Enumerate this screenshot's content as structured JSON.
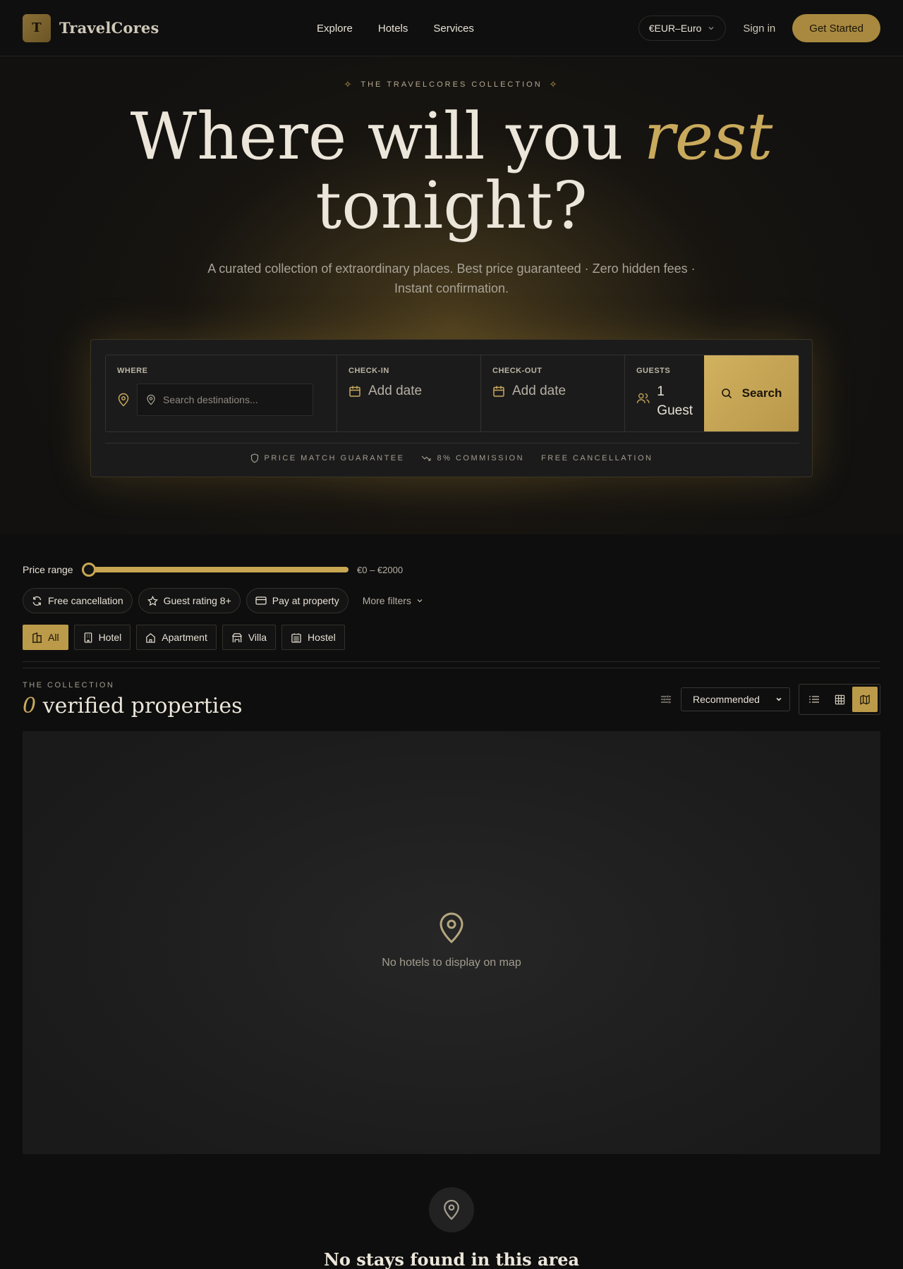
{
  "header": {
    "logo_letter": "T",
    "brand": "TravelCores",
    "nav": [
      "Explore",
      "Hotels",
      "Services"
    ],
    "currency": "€EUR–Euro",
    "sign_in": "Sign in",
    "get_started": "Get Started"
  },
  "hero": {
    "eyebrow": "THE TRAVELCORES COLLECTION",
    "title_line1": "Where will you",
    "title_accent": "rest",
    "title_line2": "tonight?",
    "subtitle": "A curated collection of extraordinary places. Best price guaranteed · Zero hidden fees · Instant confirmation."
  },
  "search": {
    "where_label": "WHERE",
    "where_placeholder": "Search destinations...",
    "checkin_label": "CHECK-IN",
    "checkin_value": "Add date",
    "checkout_label": "CHECK-OUT",
    "checkout_value": "Add date",
    "guests_label": "GUESTS",
    "guests_count": "1",
    "guests_unit": "Guest",
    "button": "Search",
    "badges": [
      "PRICE MATCH GUARANTEE",
      "8% COMMISSION",
      "FREE CANCELLATION"
    ]
  },
  "filters": {
    "price_label": "Price range",
    "price_value": "€0 – €2000",
    "price_slider_position": 0,
    "chips": [
      "Free cancellation",
      "Guest rating 8+",
      "Pay at property"
    ],
    "more": "More filters",
    "types": [
      "All",
      "Hotel",
      "Apartment",
      "Villa",
      "Hostel"
    ],
    "active_type": "All"
  },
  "collection": {
    "eyebrow": "THE COLLECTION",
    "count": "0",
    "title": "verified properties",
    "sort": "Recommended",
    "views": [
      "list",
      "grid",
      "map"
    ],
    "active_view": "map"
  },
  "map": {
    "empty_text": "No hotels to display on map"
  },
  "empty_state": {
    "title": "No stays found in this area"
  },
  "colors": {
    "gold": "#c9aa5c",
    "background": "#0e0e0e"
  }
}
